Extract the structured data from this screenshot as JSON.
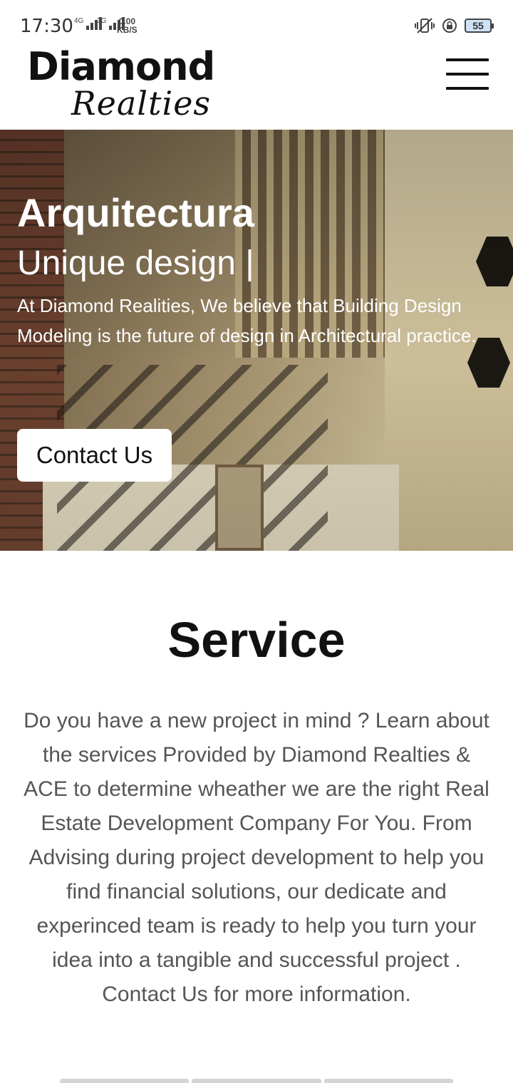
{
  "status_bar": {
    "time": "17:30",
    "net1": "4G",
    "net2": "3G",
    "speed": "0.00",
    "speed_unit": "KB/S",
    "battery": "55"
  },
  "header": {
    "logo_word": "Diamond",
    "logo_script": "Realties",
    "menu_icon": "hamburger-menu-icon"
  },
  "hero": {
    "title": "Arquitectura",
    "subtitle": "Unique design |",
    "text": "At Diamond Realities, We believe that Building Design Modeling is the future of design in Architectural practice.",
    "cta_label": "Contact Us"
  },
  "service": {
    "title": "Service",
    "text": "Do you have a new project in mind ? Learn about the services Provided by Diamond Realties & ACE to determine wheather we are the right Real Estate Development Company For You. From Advising during project development to help you find financial solutions, our dedicate and experinced team is ready to help you turn your idea into a tangible and successful project . Contact Us for more information."
  }
}
